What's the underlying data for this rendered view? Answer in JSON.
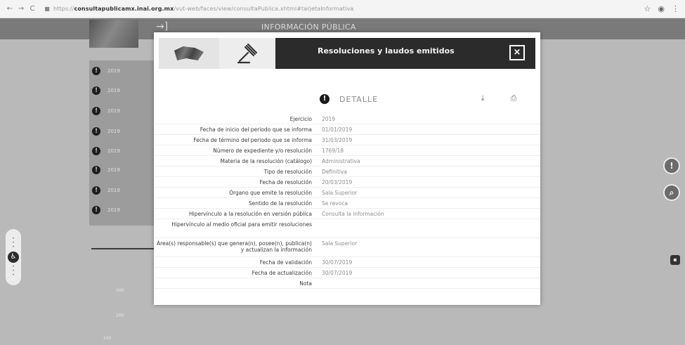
{
  "browser": {
    "back_icon": "back-arrow-icon",
    "forward_icon": "forward-arrow-icon",
    "reload_icon": "reload-icon",
    "url_prefix": "https://",
    "url_host": "consultapublicamx.inai.org.mx",
    "url_path": "/vut-web/faces/view/consultaPublica.xhtml#tarjetaInformativa"
  },
  "background": {
    "header_title": "INFORMACIÓN PÚBLICA",
    "years": [
      "2019",
      "2019",
      "2019",
      "2019",
      "2019",
      "2019",
      "2019",
      "2019"
    ],
    "axis_labels": [
      "300",
      "200",
      "100"
    ]
  },
  "modal": {
    "title": "Resoluciones y laudos emitidos",
    "close_label": "×",
    "detalle_label": "DETALLE",
    "rows": [
      {
        "label": "Ejercicio",
        "value": "2019"
      },
      {
        "label": "Fecha de inicio del periodo que se informa",
        "value": "01/01/2019"
      },
      {
        "label": "Fecha de término del periodo que se informa",
        "value": "31/03/2019"
      },
      {
        "label": "Número de expediente y/o resolución",
        "value": "1769/18"
      },
      {
        "label": "Materia de la resolución (catálogo)",
        "value": "Administrativa"
      },
      {
        "label": "Tipo de resolución",
        "value": "Definitiva"
      },
      {
        "label": "Fecha de resolución",
        "value": "20/03/2019"
      },
      {
        "label": "Órgano que emite la resolución",
        "value": "Sala Superior"
      },
      {
        "label": "Sentido de la resolución",
        "value": "Se revoca"
      },
      {
        "label": "Hipervínculo a la resolución en versión pública",
        "value": "Consulta la información"
      },
      {
        "label": "Hipervínculo al medio oficial para emitir resoluciones",
        "value": ""
      },
      {
        "label": "Área(s) responsable(s) que genera(n), posee(n), publica(n) y actualizan la información",
        "value": "Sala Superior"
      },
      {
        "label": "Fecha de validación",
        "value": "30/07/2019"
      },
      {
        "label": "Fecha de actualización",
        "value": "30/07/2019"
      },
      {
        "label": "Nota",
        "value": ""
      }
    ]
  }
}
